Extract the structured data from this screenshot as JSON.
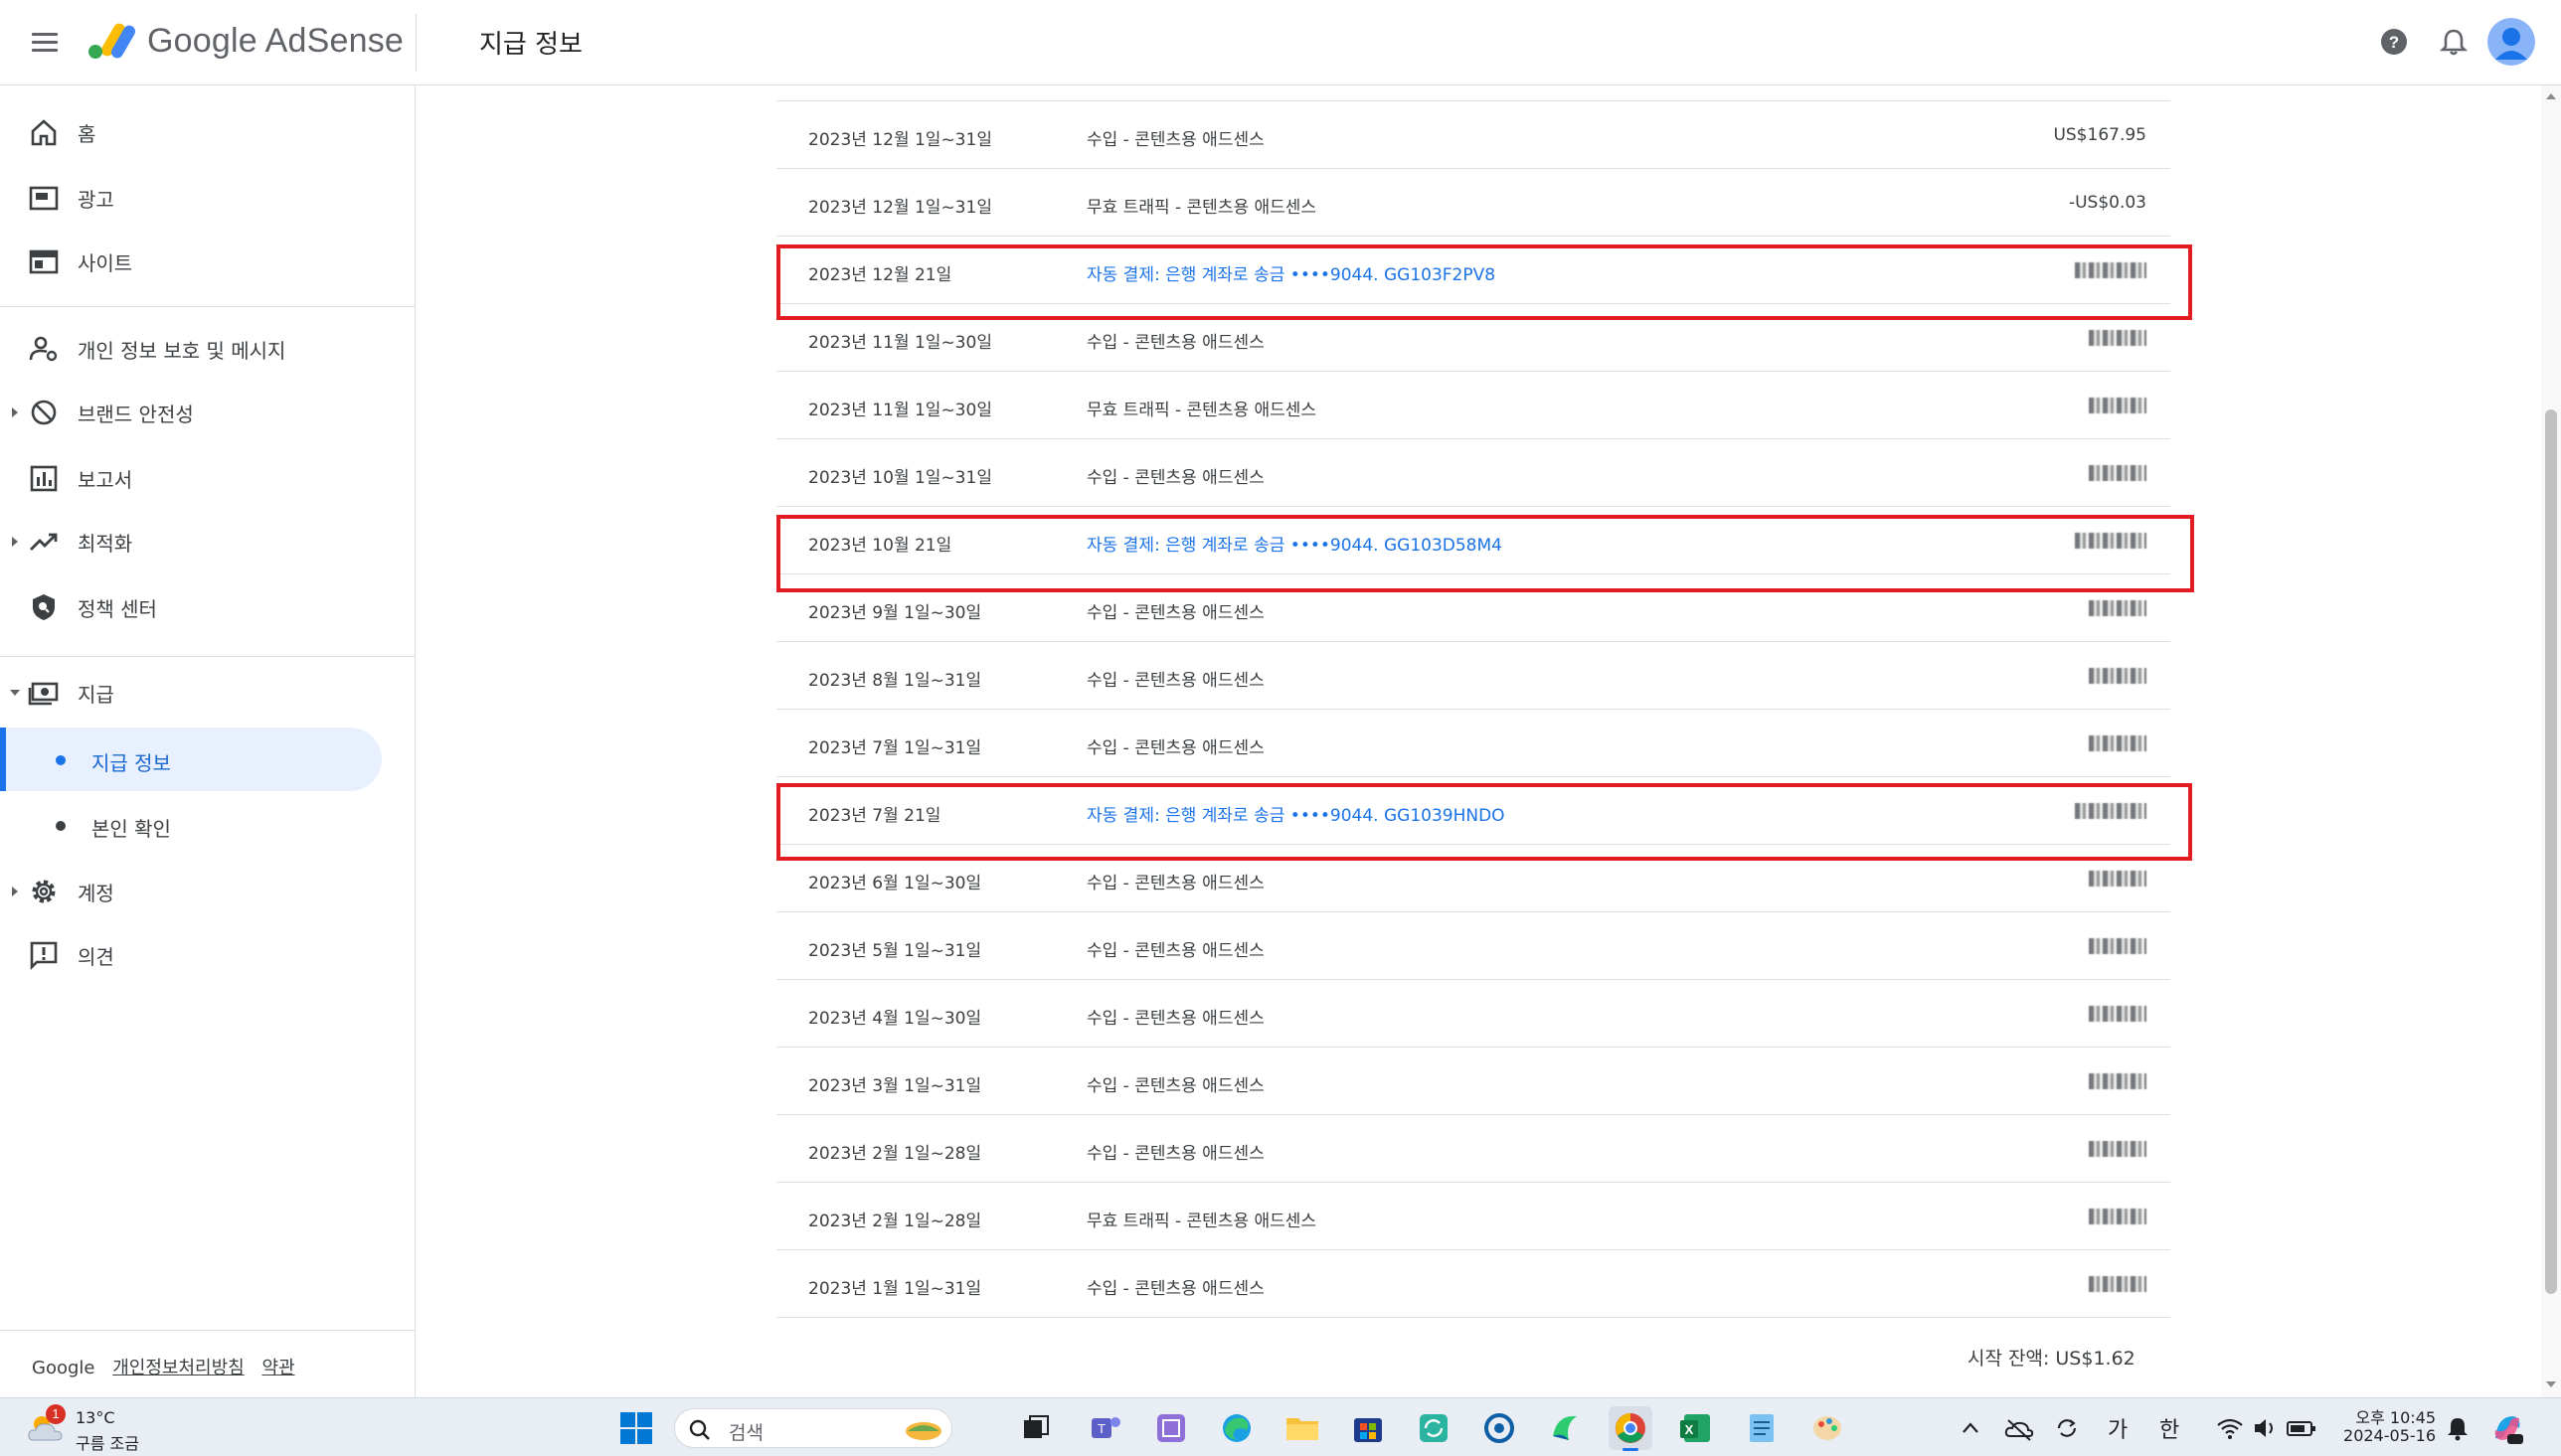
{
  "header": {
    "brand": "Google AdSense",
    "page_title": "지급 정보"
  },
  "sidebar": {
    "items": [
      {
        "label": "홈",
        "icon": "home-icon"
      },
      {
        "label": "광고",
        "icon": "ads-icon"
      },
      {
        "label": "사이트",
        "icon": "sites-icon"
      },
      {
        "label": "개인 정보 보호 및 메시지",
        "icon": "privacy-icon"
      },
      {
        "label": "브랜드 안전성",
        "icon": "block-icon"
      },
      {
        "label": "보고서",
        "icon": "reports-icon"
      },
      {
        "label": "최적화",
        "icon": "trending-icon"
      },
      {
        "label": "정책 센터",
        "icon": "policy-shield-icon"
      },
      {
        "label": "지급",
        "icon": "payments-icon"
      },
      {
        "label": "계정",
        "icon": "gear-icon"
      },
      {
        "label": "의견",
        "icon": "feedback-icon"
      }
    ],
    "sub_items": [
      {
        "label": "지급 정보"
      },
      {
        "label": "본인 확인"
      }
    ],
    "footer": {
      "brand": "Google",
      "privacy": "개인정보처리방침",
      "terms": "약관"
    }
  },
  "transactions": [
    {
      "date": "2023년 12월 1일~31일",
      "desc": "수입 - 콘텐츠용 애드센스",
      "amount": "US$167.95"
    },
    {
      "date": "2023년 12월 1일~31일",
      "desc": "무효 트래픽 - 콘텐츠용 애드센스",
      "amount": "-US$0.03"
    },
    {
      "date": "2023년 12월 21일",
      "desc": "자동 결제: 은행 계좌로 송금 ••••9044. GG103F2PV8"
    },
    {
      "date": "2023년 11월 1일~30일",
      "desc": "수입 - 콘텐츠용 애드센스"
    },
    {
      "date": "2023년 11월 1일~30일",
      "desc": "무효 트래픽 - 콘텐츠용 애드센스"
    },
    {
      "date": "2023년 10월 1일~31일",
      "desc": "수입 - 콘텐츠용 애드센스"
    },
    {
      "date": "2023년 10월 21일",
      "desc": "자동 결제: 은행 계좌로 송금 ••••9044. GG103D58M4"
    },
    {
      "date": "2023년 9월 1일~30일",
      "desc": "수입 - 콘텐츠용 애드센스"
    },
    {
      "date": "2023년 8월 1일~31일",
      "desc": "수입 - 콘텐츠용 애드센스"
    },
    {
      "date": "2023년 7월 1일~31일",
      "desc": "수입 - 콘텐츠용 애드센스"
    },
    {
      "date": "2023년 7월 21일",
      "desc": "자동 결제: 은행 계좌로 송금 ••••9044. GG1039HNDO"
    },
    {
      "date": "2023년 6월 1일~30일",
      "desc": "수입 - 콘텐츠용 애드센스"
    },
    {
      "date": "2023년 5월 1일~31일",
      "desc": "수입 - 콘텐츠용 애드센스"
    },
    {
      "date": "2023년 4월 1일~30일",
      "desc": "수입 - 콘텐츠용 애드센스"
    },
    {
      "date": "2023년 3월 1일~31일",
      "desc": "수입 - 콘텐츠용 애드센스"
    },
    {
      "date": "2023년 2월 1일~28일",
      "desc": "수입 - 콘텐츠용 애드센스"
    },
    {
      "date": "2023년 2월 1일~28일",
      "desc": "무효 트래픽 - 콘텐츠용 애드센스"
    },
    {
      "date": "2023년 1월 1일~31일",
      "desc": "수입 - 콘텐츠용 애드센스"
    }
  ],
  "start_balance": "시작 잔액: US$1.62",
  "taskbar": {
    "weather_temp": "13°C",
    "weather_desc": "구름 조금",
    "weather_badge": "1",
    "search_placeholder": "검색",
    "ime_1": "가",
    "ime_2": "한",
    "clock_time": "오후 10:45",
    "clock_date": "2024-05-16"
  },
  "colors": {
    "accent": "#1a73e8",
    "highlight": "#e31b23",
    "active_bg": "#e8f0fe"
  }
}
